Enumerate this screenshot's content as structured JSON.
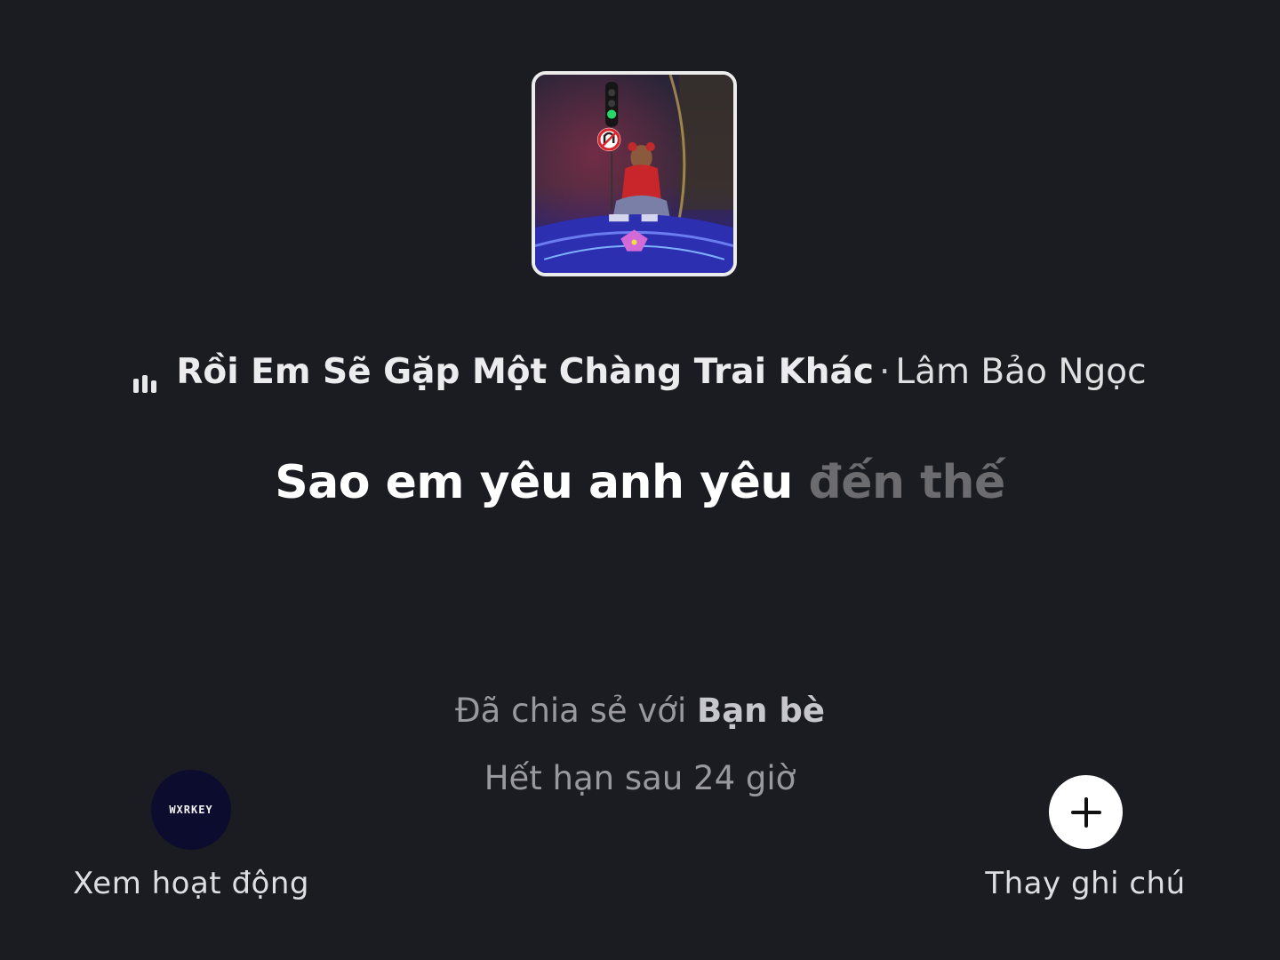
{
  "song": {
    "title": "Rồi Em Sẽ Gặp Một Chàng Trai Khác",
    "separator": "·",
    "artist": "Lâm Bảo Ngọc",
    "playing_icon": "equalizer-bars-icon"
  },
  "lyric": {
    "sung": "Sao em yêu anh yêu",
    "unsung": "đến thế"
  },
  "sharing": {
    "prefix": "Đã chia sẻ với",
    "audience": "Bạn bè",
    "expiry": "Hết hạn sau 24 giờ"
  },
  "actions": {
    "activity": {
      "avatar_text": "WXRKEY",
      "label": "Xem hoạt động"
    },
    "change_note": {
      "icon": "plus-icon",
      "label": "Thay ghi chú"
    }
  },
  "colors": {
    "background": "#1b1c21",
    "lyric_sung": "#ffffff",
    "lyric_unsung": "#6b6b70"
  }
}
